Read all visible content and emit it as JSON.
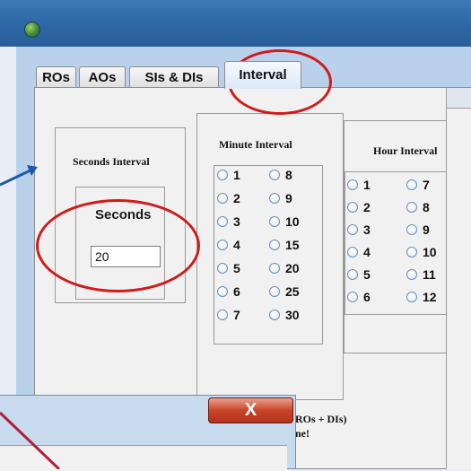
{
  "tabs": [
    "ROs",
    "AOs",
    "SIs & DIs",
    "Interval"
  ],
  "seconds": {
    "group_title": "Seconds Interval",
    "label": "Seconds",
    "value": "20"
  },
  "minutes": {
    "group_title": "Minute Interval",
    "options_col1": [
      "1",
      "2",
      "3",
      "4",
      "5",
      "6",
      "7"
    ],
    "options_col2": [
      "8",
      "9",
      "10",
      "15",
      "20",
      "25",
      "30"
    ]
  },
  "hours": {
    "group_title": "Hour Interval",
    "options_col1": [
      "1",
      "2",
      "3",
      "4",
      "5",
      "6"
    ],
    "options_col2": [
      "7",
      "8",
      "9",
      "10",
      "11",
      "12"
    ]
  },
  "bottom_note": {
    "line1": "ROs + DIs)",
    "line2": "ne!"
  },
  "dialog": {
    "close_label": "X"
  },
  "colors": {
    "annotation": "#d11a1a",
    "titlebar": "#2f6aa9"
  }
}
